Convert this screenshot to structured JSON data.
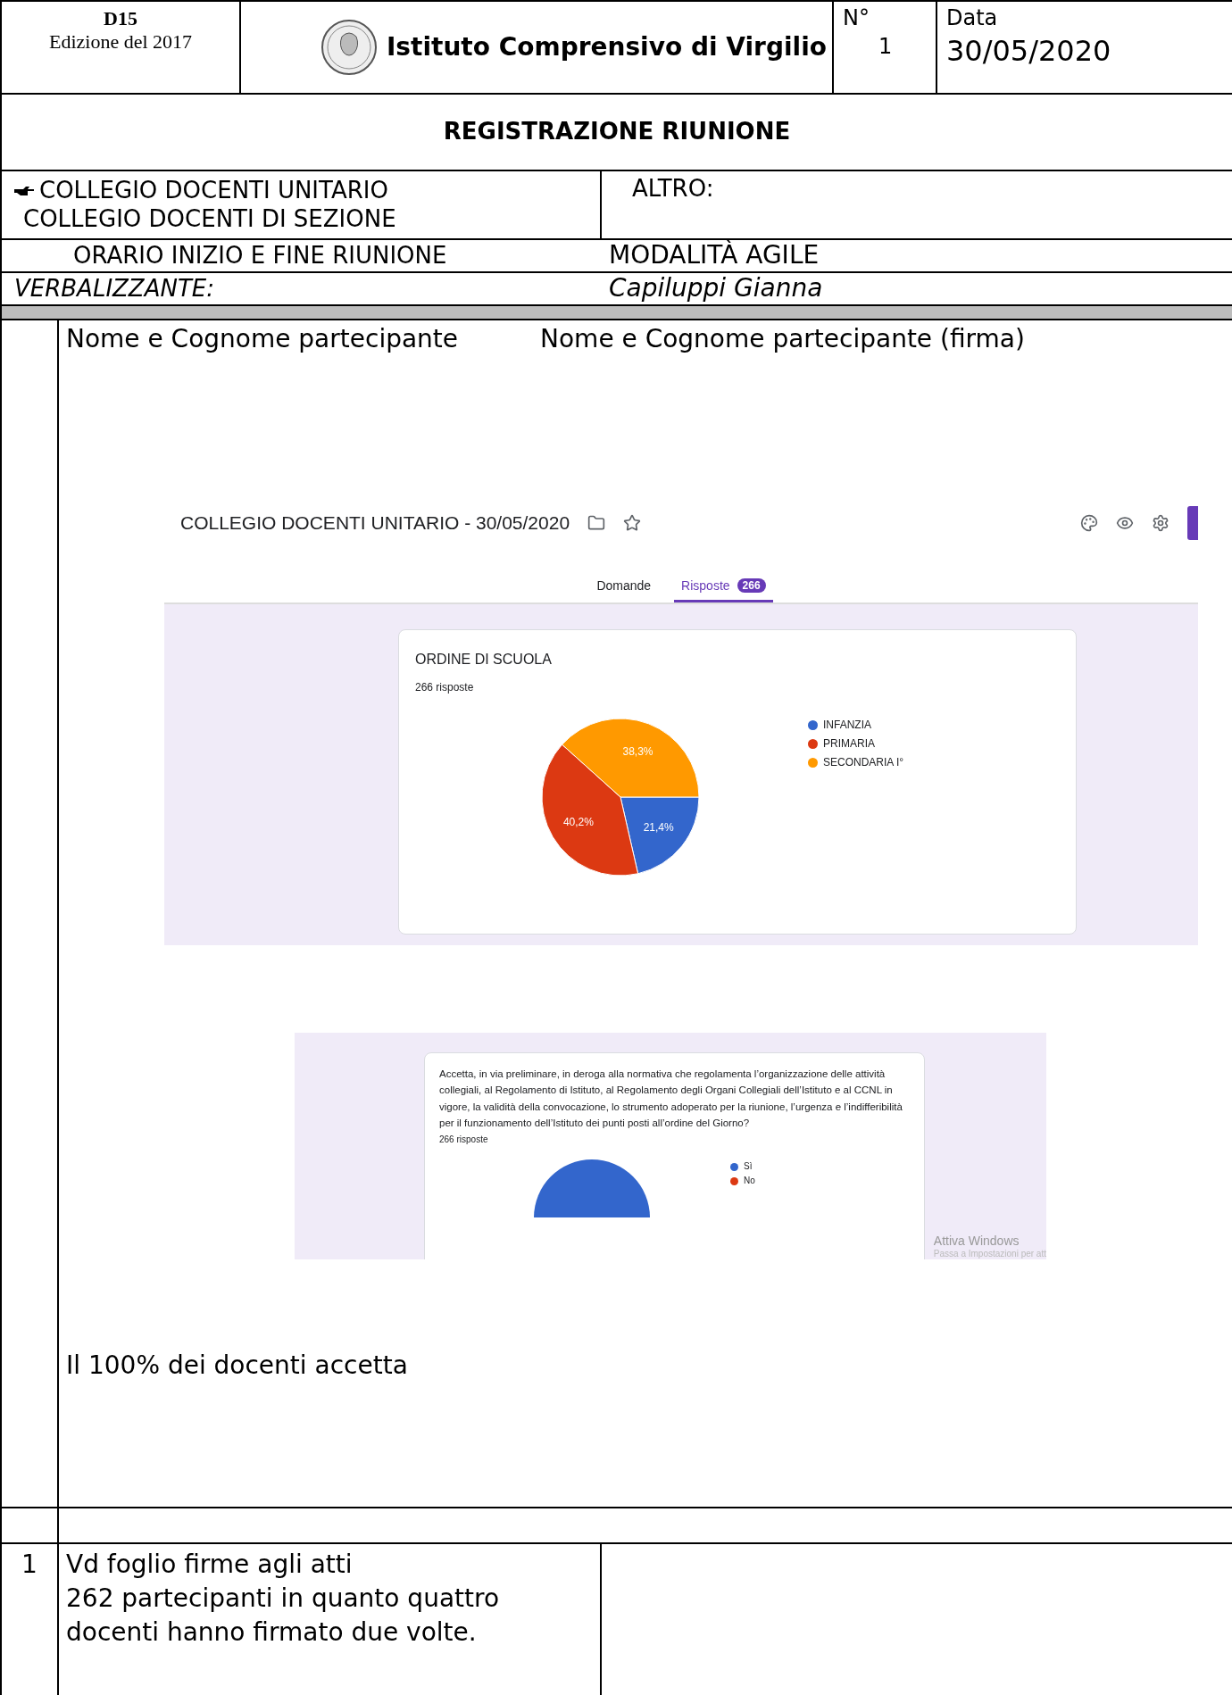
{
  "header": {
    "code": "D15",
    "edition": "Edizione del 2017",
    "institute": "Istituto Comprensivo di Virgilio",
    "number_label": "N°",
    "number": "1",
    "date_label": "Data",
    "date": "30/05/2020"
  },
  "title": "REGISTRAZIONE RIUNIONE",
  "meeting_types": [
    {
      "label": "COLLEGIO DOCENTI UNITARIO",
      "selected": true
    },
    {
      "label": "COLLEGIO DOCENTI DI SEZIONE",
      "selected": false
    }
  ],
  "other_label": "ALTRO:",
  "schedule_label": "ORARIO INIZIO E FINE RIUNIONE",
  "schedule_value": "MODALITÀ AGILE",
  "recorder_label": "VERBALIZZANTE:",
  "recorder_value": "Capiluppi Gianna",
  "participants": {
    "column_1": "Nome e Cognome partecipante",
    "column_2": "Nome e Cognome partecipante (firma)",
    "form_screenshot": {
      "title": "COLLEGIO DOCENTI UNITARIO - 30/05/2020",
      "tabs": [
        {
          "label": "Domande",
          "selected": false
        },
        {
          "label": "Risposte",
          "selected": true,
          "badge": "266"
        }
      ],
      "responses": "266 risposte",
      "chart_data": {
        "type": "pie",
        "categories": [
          "INFANZIA",
          "PRIMARIA",
          "SECONDARIA I°"
        ],
        "series": [
          {
            "name": "ORDINE DI SCUOLA",
            "values": [
              21.4,
              40.2,
              38.3
            ]
          }
        ],
        "colors": [
          "#3366cc",
          "#dc3912",
          "#ff9900"
        ],
        "value_labels": [
          "21,4%",
          "40,2%",
          "38,3%"
        ]
      }
    },
    "question_screenshot": {
      "question": "Accetta, in via preliminare, in deroga alla normativa che regolamenta l’organizzazione delle attività collegiali, al Regolamento di Istituto, al Regolamento degli Organi Collegiali dell’Istituto e al CCNL in vigore, la validità della convocazione, lo strumento adoperato per la riunione, l’urgenza e l’indifferibilità per il funzionamento dell’Istituto dei punti posti all’ordine del Giorno?",
      "responses": "266 risposte",
      "legend": [
        {
          "label": "Sì",
          "color": "#3366cc"
        },
        {
          "label": "No",
          "color": "#dc3912"
        }
      ],
      "windows_notice": "Attiva Windows",
      "windows_hint": "Passa a Impostazioni per att"
    },
    "result": "Il 100% dei docenti accetta"
  },
  "rows": [
    {
      "number": "1",
      "text": "Vd foglio firme agli atti\n262 partecipanti in quanto quattro\ndocenti hanno firmato due volte."
    }
  ]
}
